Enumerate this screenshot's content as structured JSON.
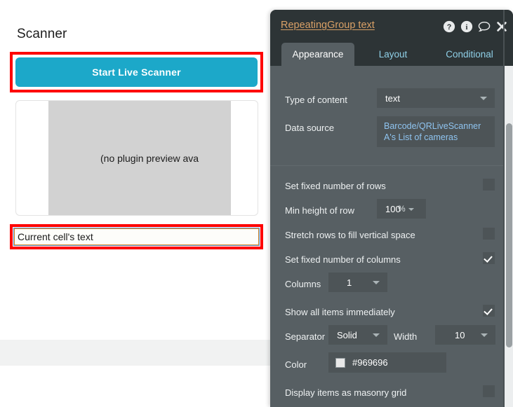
{
  "canvas": {
    "page_title": "Scanner",
    "scan_button_label": "Start Live Scanner",
    "preview_placeholder": "(no plugin preview ava",
    "cell_text_label": "Current cell's text"
  },
  "panel": {
    "title": "RepeatingGroup text",
    "header_icons": [
      {
        "name": "help-icon",
        "glyph": "question-circle"
      },
      {
        "name": "info-icon",
        "glyph": "info-circle"
      },
      {
        "name": "comment-icon",
        "glyph": "speech-bubble"
      },
      {
        "name": "close-icon",
        "glyph": "x-mark"
      }
    ],
    "tabs": [
      {
        "label": "Appearance",
        "active": true
      },
      {
        "label": "Layout",
        "active": false
      },
      {
        "label": "Conditional",
        "active": false
      }
    ],
    "properties": {
      "type_of_content_label": "Type of content",
      "type_of_content_value": "text",
      "data_source_label": "Data source",
      "data_source_value": "Barcode/QRLiveScanner A's List of cameras",
      "set_fixed_rows_label": "Set fixed number of rows",
      "set_fixed_rows_checked": false,
      "min_height_label": "Min height of row",
      "min_height_value": "100",
      "min_height_unit": "%",
      "stretch_rows_label": "Stretch rows to fill vertical space",
      "stretch_rows_checked": false,
      "set_fixed_columns_label": "Set fixed number of columns",
      "set_fixed_columns_checked": true,
      "columns_label": "Columns",
      "columns_value": "1",
      "show_all_items_label": "Show all items immediately",
      "show_all_items_checked": true,
      "separator_label": "Separator",
      "separator_value": "Solid",
      "width_label": "Width",
      "width_value": "10",
      "color_label": "Color",
      "color_value": "#969696",
      "masonry_label": "Display items as masonry grid",
      "masonry_checked": false
    }
  },
  "colors": {
    "accent_button": "#1ca8c9",
    "highlight_box": "#fe0000",
    "panel_bg": "#575f63",
    "panel_header_bg": "#2d3436",
    "title_text": "#d9a066",
    "link_text": "#8fc4f0",
    "separator_color": "#969696"
  }
}
